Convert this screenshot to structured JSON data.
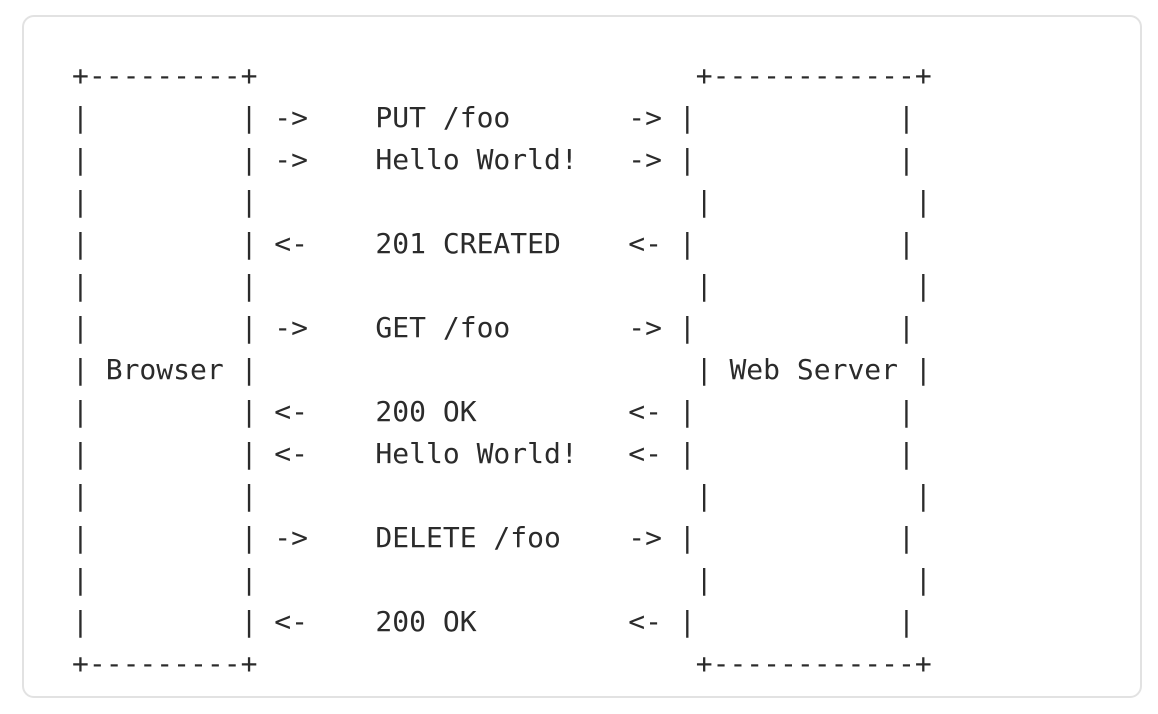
{
  "diagram": {
    "lines": [
      "+---------+                          +------------+",
      "|         | ->    PUT /foo       -> |            |",
      "|         | ->    Hello World!   -> |            |",
      "|         |                          |            |",
      "|         | <-    201 CREATED    <- |            |",
      "|         |                          |            |",
      "|         | ->    GET /foo       -> |            |",
      "| Browser |                          | Web Server |",
      "|         | <-    200 OK         <- |            |",
      "|         | <-    Hello World!   <- |            |",
      "|         |                          |            |",
      "|         | ->    DELETE /foo    -> |            |",
      "|         |                          |            |",
      "|         | <-    200 OK         <- |            |",
      "+---------+                          +------------+"
    ]
  }
}
